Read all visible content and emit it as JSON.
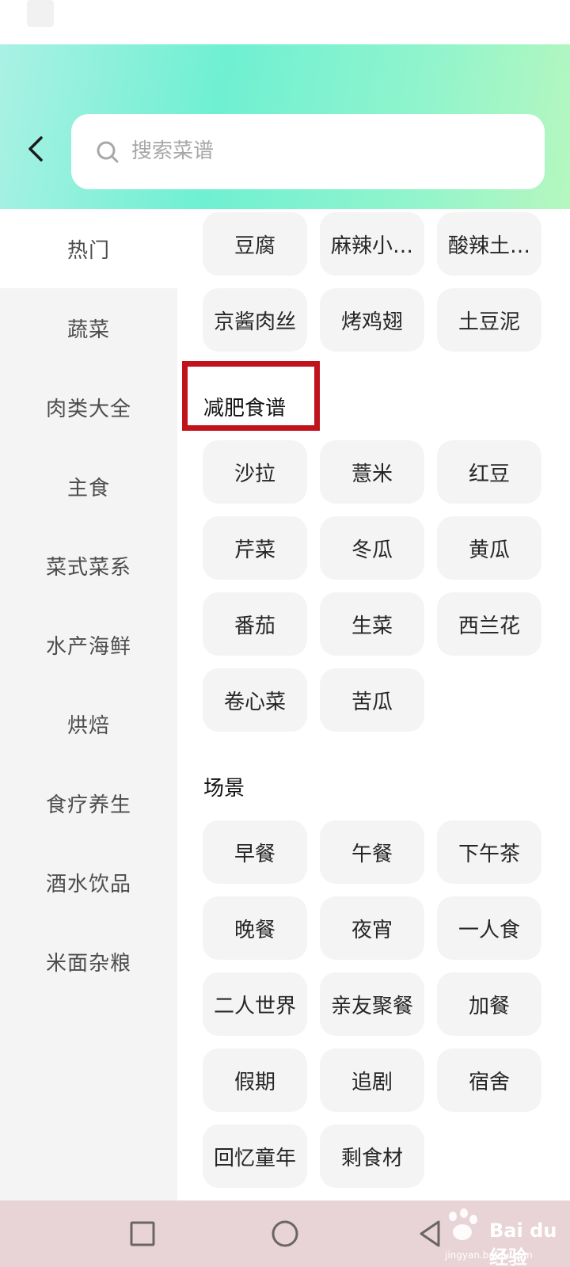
{
  "search": {
    "placeholder": "搜索菜谱"
  },
  "sidebar": {
    "items": [
      {
        "label": "热门",
        "active": true
      },
      {
        "label": "蔬菜",
        "active": false
      },
      {
        "label": "肉类大全",
        "active": false
      },
      {
        "label": "主食",
        "active": false
      },
      {
        "label": "菜式菜系",
        "active": false
      },
      {
        "label": "水产海鲜",
        "active": false
      },
      {
        "label": "烘焙",
        "active": false
      },
      {
        "label": "食疗养生",
        "active": false
      },
      {
        "label": "酒水饮品",
        "active": false
      },
      {
        "label": "米面杂粮",
        "active": false
      }
    ]
  },
  "content": {
    "top_chips": [
      "豆腐",
      "麻辣小…",
      "酸辣土…",
      "京酱肉丝",
      "烤鸡翅",
      "土豆泥"
    ],
    "sections": [
      {
        "title": "减肥食谱",
        "highlighted": true,
        "chips": [
          "沙拉",
          "薏米",
          "红豆",
          "芹菜",
          "冬瓜",
          "黄瓜",
          "番茄",
          "生菜",
          "西兰花",
          "卷心菜",
          "苦瓜"
        ]
      },
      {
        "title": "场景",
        "highlighted": false,
        "chips": [
          "早餐",
          "午餐",
          "下午茶",
          "晚餐",
          "夜宵",
          "一人食",
          "二人世界",
          "亲友聚餐",
          "加餐",
          "假期",
          "追剧",
          "宿舍",
          "回忆童年",
          "剩食材"
        ]
      }
    ]
  },
  "watermark": {
    "brand": "Bai du 经验",
    "url": "jingyan.baidu.com"
  },
  "colors": {
    "highlight_border": "#c1131b",
    "header_gradient_start": "#aaf1e4",
    "header_gradient_end": "#b6f7bf",
    "sidebar_bg": "#f4f4f4",
    "chip_bg": "#f4f4f4",
    "nav_bar_bg": "#e8d3d6"
  },
  "icons": {
    "back": "chevron-left-icon",
    "search": "search-icon",
    "nav_recent": "square-icon",
    "nav_home": "circle-icon",
    "nav_back": "triangle-back-icon"
  }
}
